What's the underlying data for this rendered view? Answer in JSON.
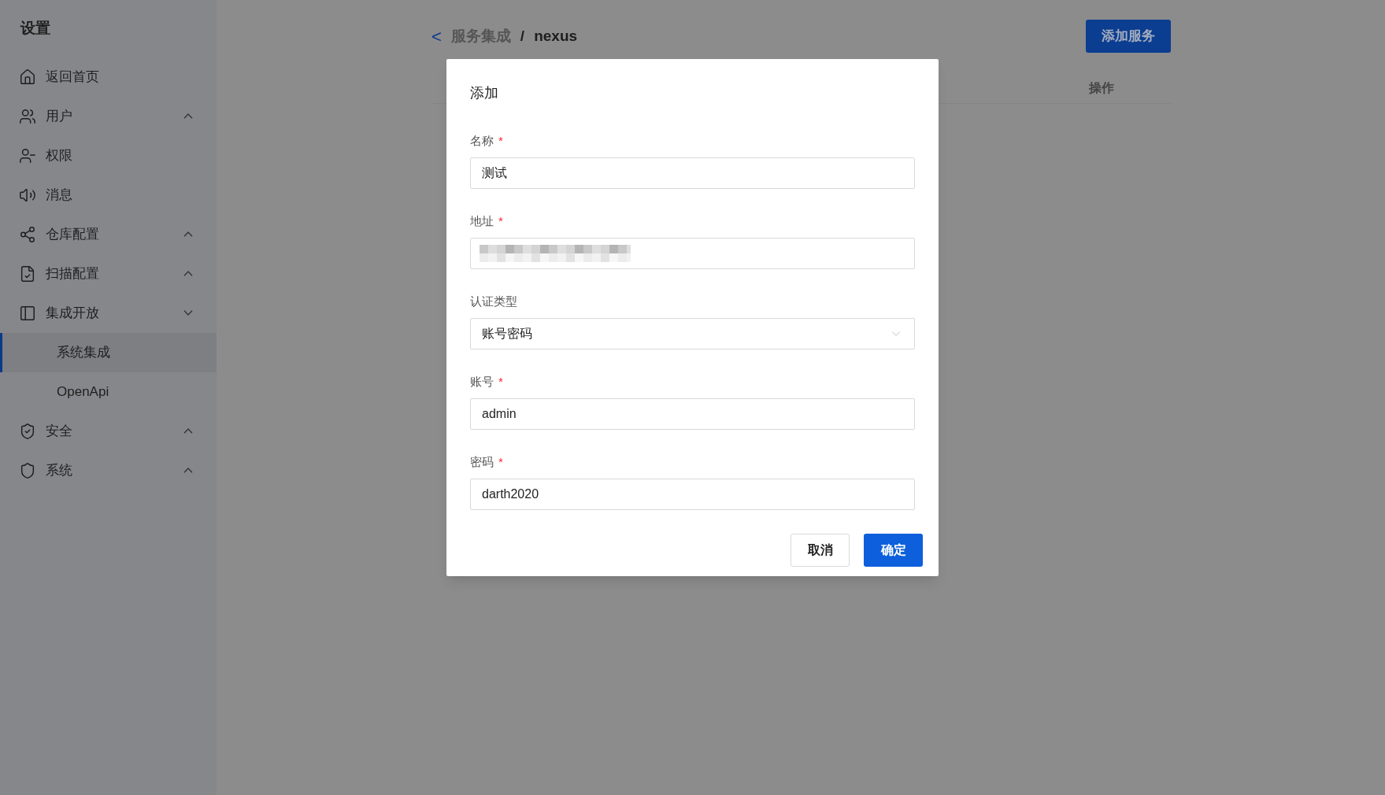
{
  "sidebar": {
    "title": "设置",
    "items": [
      {
        "label": "返回首页"
      },
      {
        "label": "用户",
        "expanded": false
      },
      {
        "label": "权限"
      },
      {
        "label": "消息"
      },
      {
        "label": "仓库配置",
        "expanded": false
      },
      {
        "label": "扫描配置",
        "expanded": false
      },
      {
        "label": "集成开放",
        "expanded": true,
        "children": [
          {
            "label": "系统集成",
            "selected": true
          },
          {
            "label": "OpenApi",
            "selected": false
          }
        ]
      },
      {
        "label": "安全",
        "expanded": false
      },
      {
        "label": "系统",
        "expanded": false
      }
    ]
  },
  "header": {
    "back": "<",
    "breadcrumb": [
      "服务集成",
      "nexus"
    ],
    "separator": "/",
    "action": "添加服务"
  },
  "table": {
    "columns": [
      "操作"
    ]
  },
  "dialog": {
    "title": "添加",
    "required_mark": "*",
    "fields": [
      {
        "kind": "input",
        "label": "名称",
        "required": true,
        "value": "测试"
      },
      {
        "kind": "input",
        "label": "地址",
        "required": true,
        "value_redacted": true
      },
      {
        "kind": "select",
        "label": "认证类型",
        "required": false,
        "value": "账号密码"
      },
      {
        "kind": "input",
        "label": "账号",
        "required": true,
        "value": "admin"
      },
      {
        "kind": "input",
        "label": "密码",
        "required": true,
        "value": "darth2020"
      }
    ],
    "buttons": [
      {
        "label": "取消",
        "primary": false
      },
      {
        "label": "确定",
        "primary": true
      }
    ]
  }
}
